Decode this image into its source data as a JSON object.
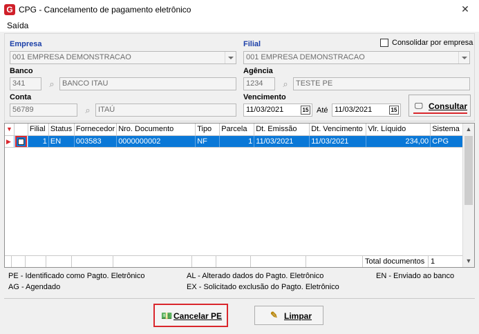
{
  "window": {
    "title": "CPG - Cancelamento de pagamento eletrônico",
    "close_glyph": "✕",
    "app_icon": "G"
  },
  "menu": {
    "items": [
      "Saída"
    ]
  },
  "filters": {
    "empresa_label": "Empresa",
    "empresa_value": "001 EMPRESA DEMONSTRACAO",
    "filial_label": "Filial",
    "filial_value": "001 EMPRESA DEMONSTRACAO",
    "consolidar_label": "Consolidar por empresa",
    "banco_label": "Banco",
    "banco_code": "341",
    "banco_name": "BANCO ITAU",
    "agencia_label": "Agência",
    "agencia_code": "1234",
    "agencia_name": "TESTE PE",
    "conta_label": "Conta",
    "conta_code": "56789",
    "conta_name": "ITAÚ",
    "vencimento_label": "Vencimento",
    "venc_de": "11/03/2021",
    "ate_label": "Até",
    "venc_ate": "11/03/2021",
    "calendar_glyph": "15",
    "consultar_label": "Consultar"
  },
  "grid": {
    "columns": [
      "Filial",
      "Status",
      "Fornecedor",
      "Nro. Documento",
      "Tipo",
      "Parcela",
      "Dt. Emissão",
      "Dt. Vencimento",
      "Vlr. Líquido",
      "Sistema"
    ],
    "rows": [
      {
        "filial": "1",
        "status": "EN",
        "fornecedor": "003583",
        "nro_documento": "0000000002",
        "tipo": "NF",
        "parcela": "1",
        "dt_emissao": "11/03/2021",
        "dt_vencimento": "11/03/2021",
        "vlr_liquido": "234,00",
        "sistema": "CPG"
      }
    ],
    "total_label": "Total documentos",
    "total_value": "1"
  },
  "legend": {
    "pe": "PE - Identificado como Pagto. Eletrônico",
    "al": "AL - Alterado dados do Pagto. Eletrônico",
    "en": "EN - Enviado ao banco",
    "ag": "AG - Agendado",
    "ex": "EX - Solicitado exclusão do Pagto. Eletrônico"
  },
  "actions": {
    "cancelar_label": "Cancelar PE",
    "limpar_label": "Limpar"
  },
  "colors": {
    "selection": "#0a78d7",
    "highlight": "#d9262c",
    "label_blue": "#1b3fa8"
  }
}
